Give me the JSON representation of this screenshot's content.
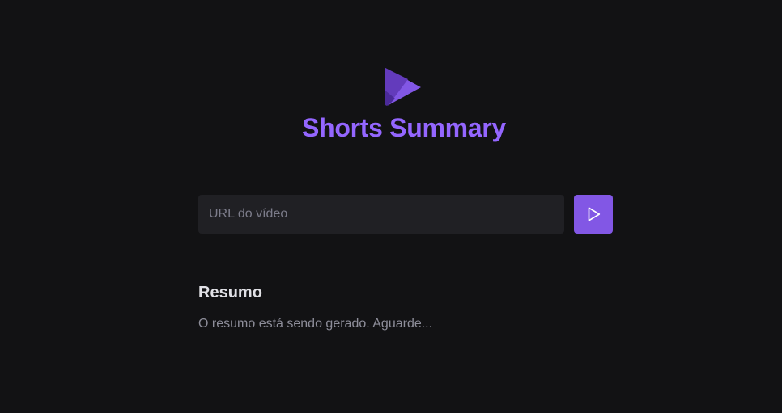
{
  "app": {
    "title": "Shorts Summary",
    "logo_icon": "play-logo-icon"
  },
  "search": {
    "placeholder": "URL do vídeo",
    "value": "",
    "submit_icon": "play-icon"
  },
  "summary": {
    "heading": "Resumo",
    "status_text": "O resumo está sendo gerado. Aguarde..."
  },
  "colors": {
    "background": "#121214",
    "input_background": "#202024",
    "accent": "#8257e5",
    "title": "#9466ff",
    "heading": "#e1e1e6",
    "muted_text": "#8d8d99"
  }
}
